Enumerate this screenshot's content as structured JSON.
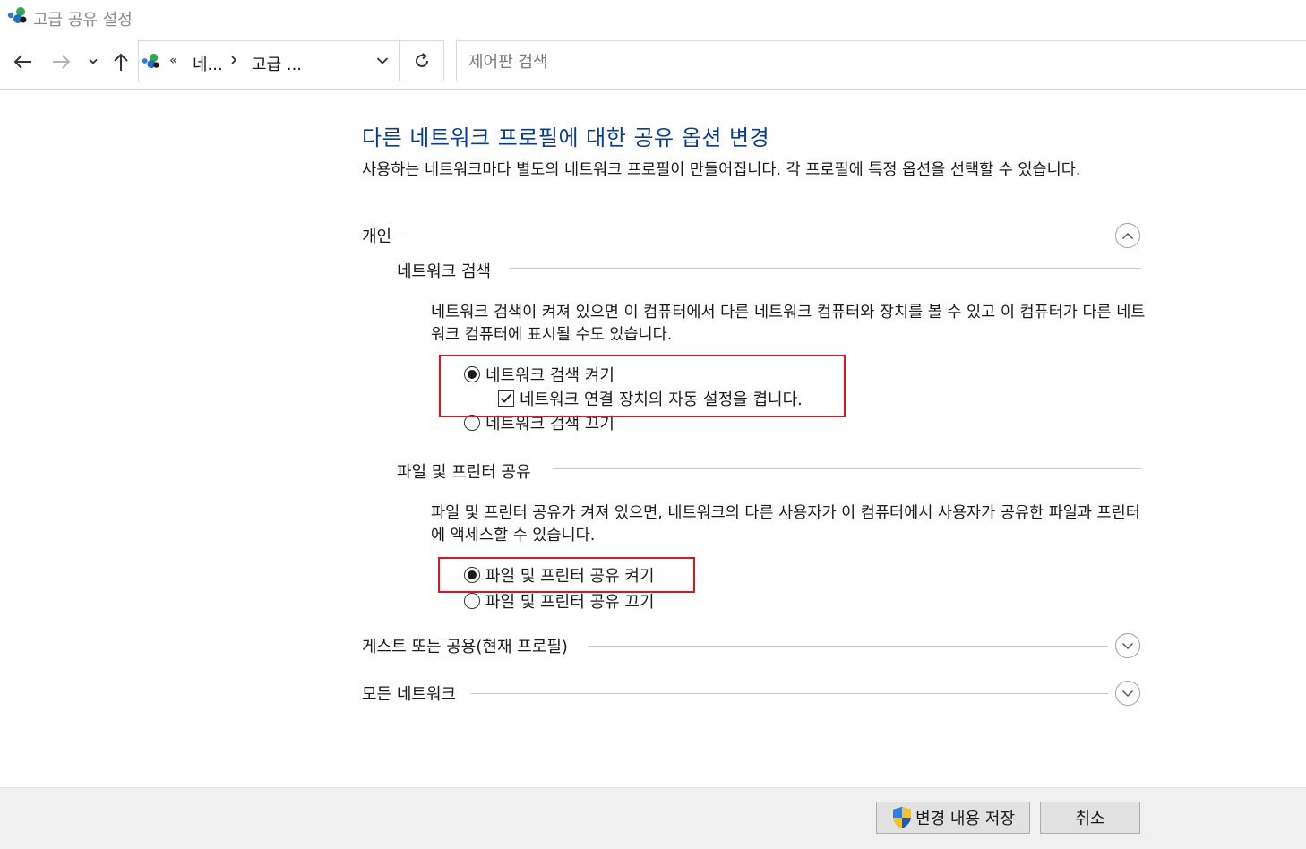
{
  "window": {
    "title": "고급 공유 설정"
  },
  "navigation": {
    "breadcrumbs": [
      "네...",
      "고급 ..."
    ],
    "search_placeholder": "제어판 검색"
  },
  "main": {
    "title": "다른 네트워크 프로필에 대한 공유 옵션 변경",
    "description": "사용하는 네트워크마다 별도의 네트워크 프로필이 만들어집니다. 각 프로필에 특정 옵션을 선택할 수 있습니다.",
    "profiles": {
      "private": {
        "label": "개인",
        "expanded": true
      },
      "guest": {
        "label": "게스트 또는 공용(현재 프로필)",
        "expanded": false
      },
      "all": {
        "label": "모든 네트워크",
        "expanded": false
      }
    },
    "network_discovery": {
      "header": "네트워크 검색",
      "description": "네트워크 검색이 켜져 있으면 이 컴퓨터에서 다른 네트워크 컴퓨터와 장치를 볼 수 있고 이 컴퓨터가 다른 네트워크 컴퓨터에 표시될 수도 있습니다.",
      "on_label": "네트워크 검색 켜기",
      "auto_setup_label": "네트워크 연결 장치의 자동 설정을 켭니다.",
      "off_label": "네트워크 검색 끄기",
      "selected": "on",
      "auto_setup_checked": true
    },
    "file_sharing": {
      "header": "파일 및 프린터 공유",
      "description": "파일 및 프린터 공유가 켜져 있으면, 네트워크의 다른 사용자가 이 컴퓨터에서 사용자가 공유한 파일과 프린터에 액세스할 수 있습니다.",
      "on_label": "파일 및 프린터 공유 켜기",
      "off_label": "파일 및 프린터 공유 끄기",
      "selected": "on"
    }
  },
  "footer": {
    "save_label": "변경 내용 저장",
    "cancel_label": "취소"
  },
  "colors": {
    "title_blue": "#0a3d91",
    "highlight_red": "#e0141e",
    "footer_bg": "#f0f0f0"
  }
}
